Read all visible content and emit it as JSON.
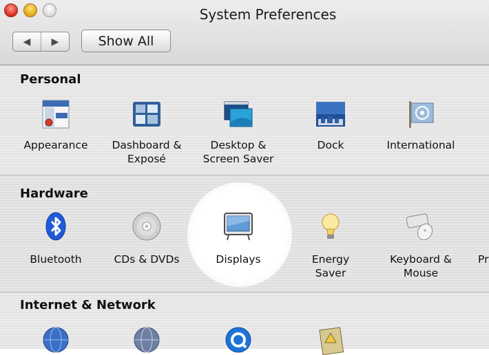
{
  "window": {
    "title": "System Preferences"
  },
  "toolbar": {
    "show_all_label": "Show All",
    "back_glyph": "◀",
    "forward_glyph": "▶"
  },
  "sections": {
    "personal": {
      "header": "Personal",
      "items": [
        {
          "label": "Appearance",
          "icon": "appearance-icon"
        },
        {
          "label": "Dashboard &\nExposé",
          "icon": "dashboard-expose-icon"
        },
        {
          "label": "Desktop &\nScreen Saver",
          "icon": "desktop-screensaver-icon"
        },
        {
          "label": "Dock",
          "icon": "dock-icon"
        },
        {
          "label": "International",
          "icon": "international-flag-icon"
        }
      ]
    },
    "hardware": {
      "header": "Hardware",
      "items": [
        {
          "label": "Bluetooth",
          "icon": "bluetooth-icon"
        },
        {
          "label": "CDs & DVDs",
          "icon": "cd-dvd-icon"
        },
        {
          "label": "Displays",
          "icon": "display-icon",
          "highlighted": true
        },
        {
          "label": "Energy\nSaver",
          "icon": "lightbulb-icon"
        },
        {
          "label": "Keyboard &\nMouse",
          "icon": "keyboard-mouse-icon"
        },
        {
          "label": "Pr",
          "icon": "printer-icon"
        }
      ]
    },
    "internet": {
      "header": "Internet & Network",
      "items": [
        {
          "icon": "mac-globe-icon"
        },
        {
          "icon": "network-globe-icon"
        },
        {
          "icon": "quicktime-icon"
        },
        {
          "icon": "sharing-icon"
        }
      ]
    }
  },
  "colors": {
    "bluetooth": "#1f5bd8",
    "highlight": "#ffffff"
  }
}
